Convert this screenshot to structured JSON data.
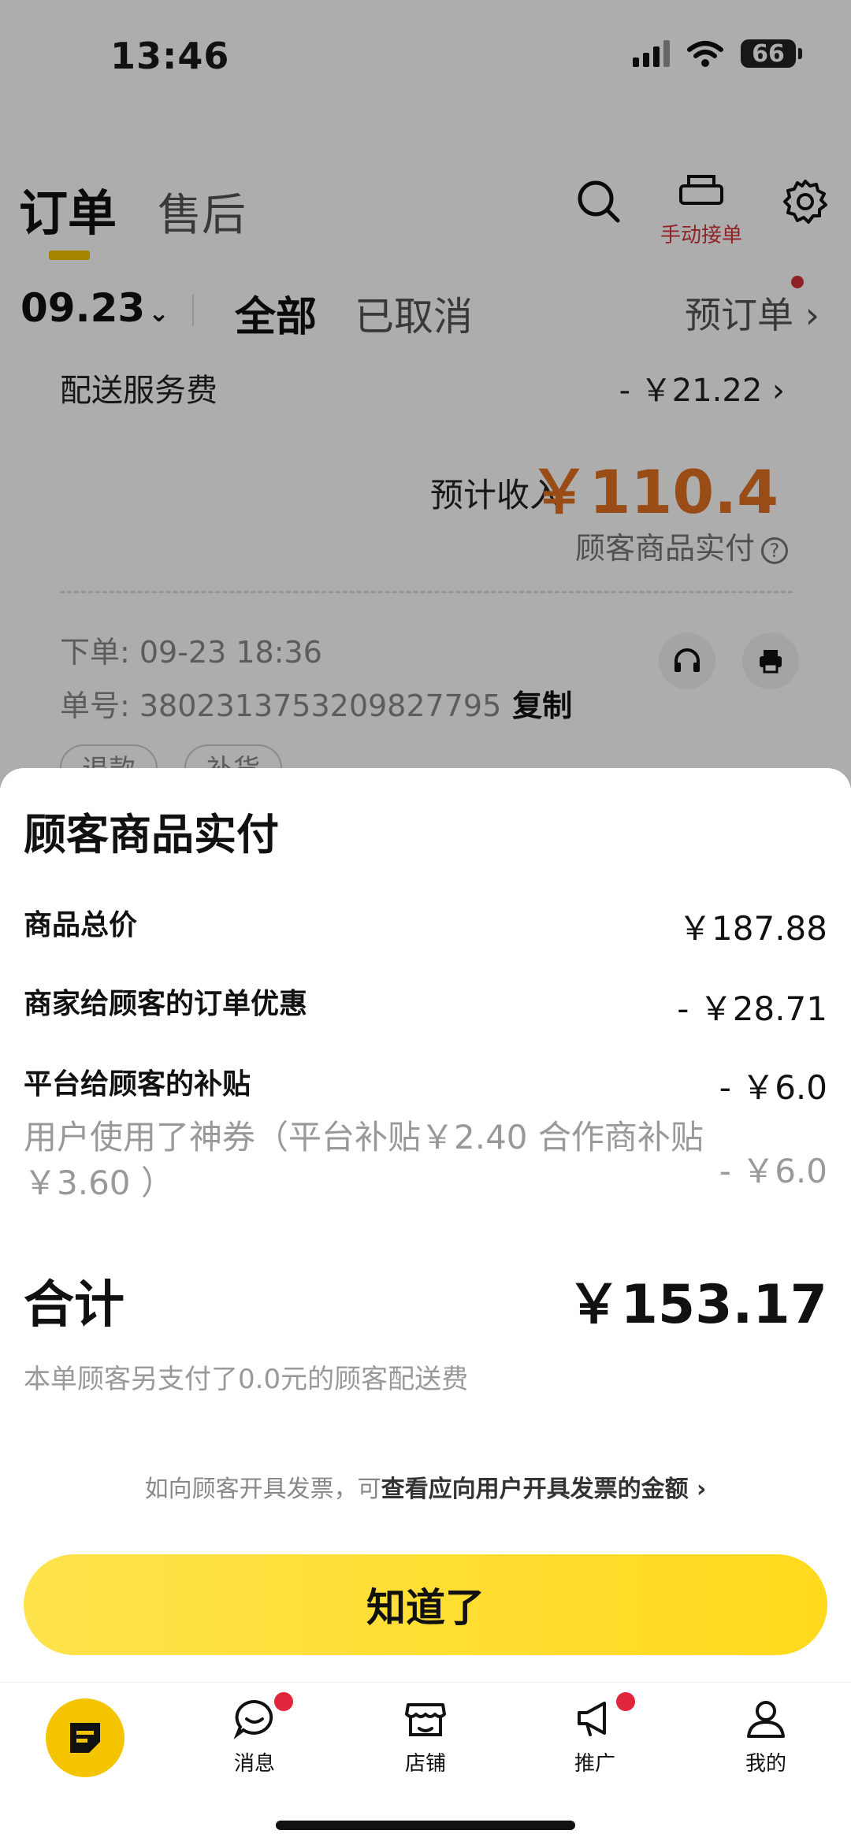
{
  "status_bar": {
    "time": "13:46",
    "battery": "66"
  },
  "header": {
    "tab_orders": "订单",
    "tab_after_sales": "售后",
    "manual_accept_label": "手动接单"
  },
  "sub_bar": {
    "date": "09.23",
    "filter_all": "全部",
    "filter_cancelled": "已取消",
    "preorder": "预订单 ›"
  },
  "order_card": {
    "fee_label": "配送服务费",
    "fee_value": "- ￥21.22 ›",
    "income_label": "预计收入",
    "income_value": "￥110.4",
    "paid_link": "顾客商品实付",
    "order_time": "下单: 09-23 18:36",
    "order_no": "单号: 3802313753209827795",
    "copy_label": "复制",
    "chips": [
      "退款",
      "补货"
    ]
  },
  "sheet": {
    "title": "顾客商品实付",
    "rows": [
      {
        "label": "商品总价",
        "value": "￥187.88"
      },
      {
        "label": "商家给顾客的订单优惠",
        "value": "- ￥28.71"
      },
      {
        "label": "平台给顾客的补贴",
        "value": "- ￥6.0"
      }
    ],
    "coupon_label": "用户使用了神券（平台补贴￥2.40 合作商补贴￥3.60 ）",
    "coupon_value": "- ￥6.0",
    "total_label": "合计",
    "total_value": "￥153.17",
    "delivery_note": "本单顾客另支付了0.0元的顾客配送费",
    "invoice_prefix": "如向顾客开具发票，可",
    "invoice_link": "查看应向用户开具发票的金额 ›",
    "ok_button": "知道了"
  },
  "tabbar": {
    "items": [
      {
        "label": "消息",
        "icon": "chat-icon"
      },
      {
        "label": "店铺",
        "icon": "store-icon"
      },
      {
        "label": "推广",
        "icon": "megaphone-icon"
      },
      {
        "label": "我的",
        "icon": "user-icon"
      }
    ]
  },
  "colors": {
    "accent": "#f5c400",
    "income": "#e2711f",
    "badge": "#e0263a"
  }
}
